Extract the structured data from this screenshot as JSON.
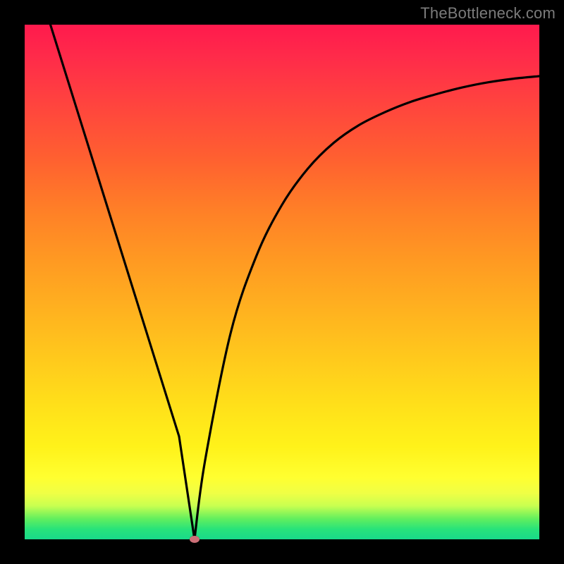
{
  "watermark": "TheBottleneck.com",
  "chart_data": {
    "type": "line",
    "title": "",
    "xlabel": "",
    "ylabel": "",
    "xlim": [
      0,
      100
    ],
    "ylim": [
      0,
      100
    ],
    "grid": false,
    "legend": false,
    "series": [
      {
        "name": "bottleneck-curve",
        "x": [
          5,
          10,
          15,
          20,
          25,
          30,
          33,
          35,
          40,
          45,
          50,
          55,
          60,
          65,
          70,
          75,
          80,
          85,
          90,
          95,
          100
        ],
        "y": [
          100,
          84,
          68,
          52,
          36,
          20,
          0,
          15,
          40,
          55,
          65,
          72,
          77,
          80.5,
          83,
          85,
          86.5,
          87.8,
          88.8,
          89.5,
          90
        ]
      }
    ],
    "annotations": [
      {
        "name": "optimal-point",
        "x": 33,
        "y": 0
      }
    ],
    "background": "vertical-gradient red→green"
  }
}
